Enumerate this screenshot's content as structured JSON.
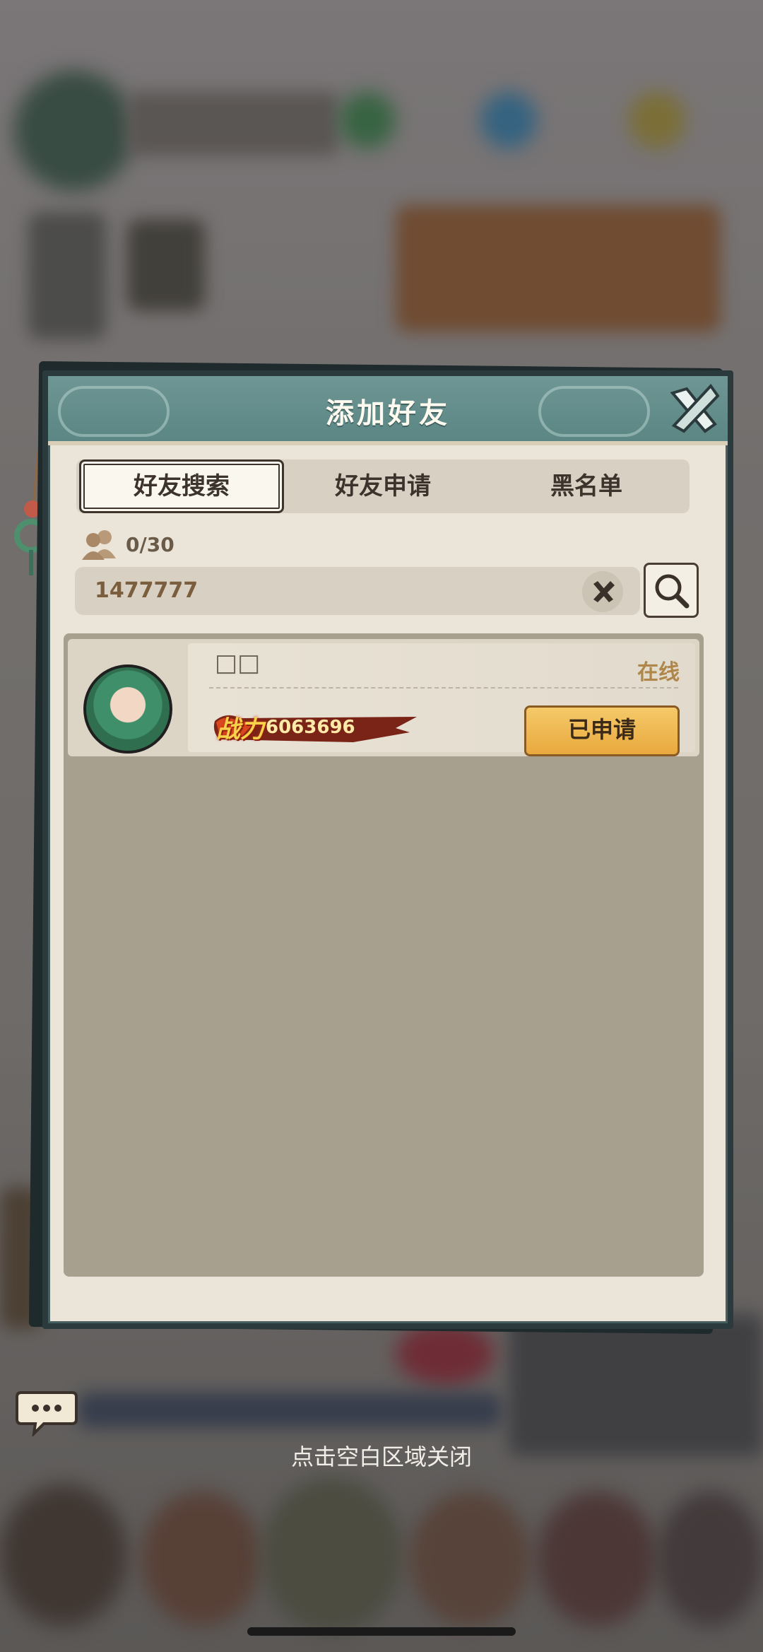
{
  "dialog": {
    "title": "添加好友",
    "tabs": [
      {
        "label": "好友搜索",
        "active": true
      },
      {
        "label": "好友申请",
        "active": false
      },
      {
        "label": "黑名单",
        "active": false
      }
    ],
    "friend_count": "0/30",
    "search": {
      "value": "1477777"
    },
    "results": [
      {
        "name": "□□",
        "status": "在线",
        "power_label": "战力",
        "power": "6063696",
        "action_label": "已申请"
      }
    ]
  },
  "hint": {
    "close_text": "点击空白区域关闭"
  },
  "colors": {
    "title_bar": "#5b8683",
    "panel": "#ebe5d9",
    "list_bg": "#a7a08f",
    "button_gold": "#e9a93e",
    "status_text": "#b0874a"
  }
}
